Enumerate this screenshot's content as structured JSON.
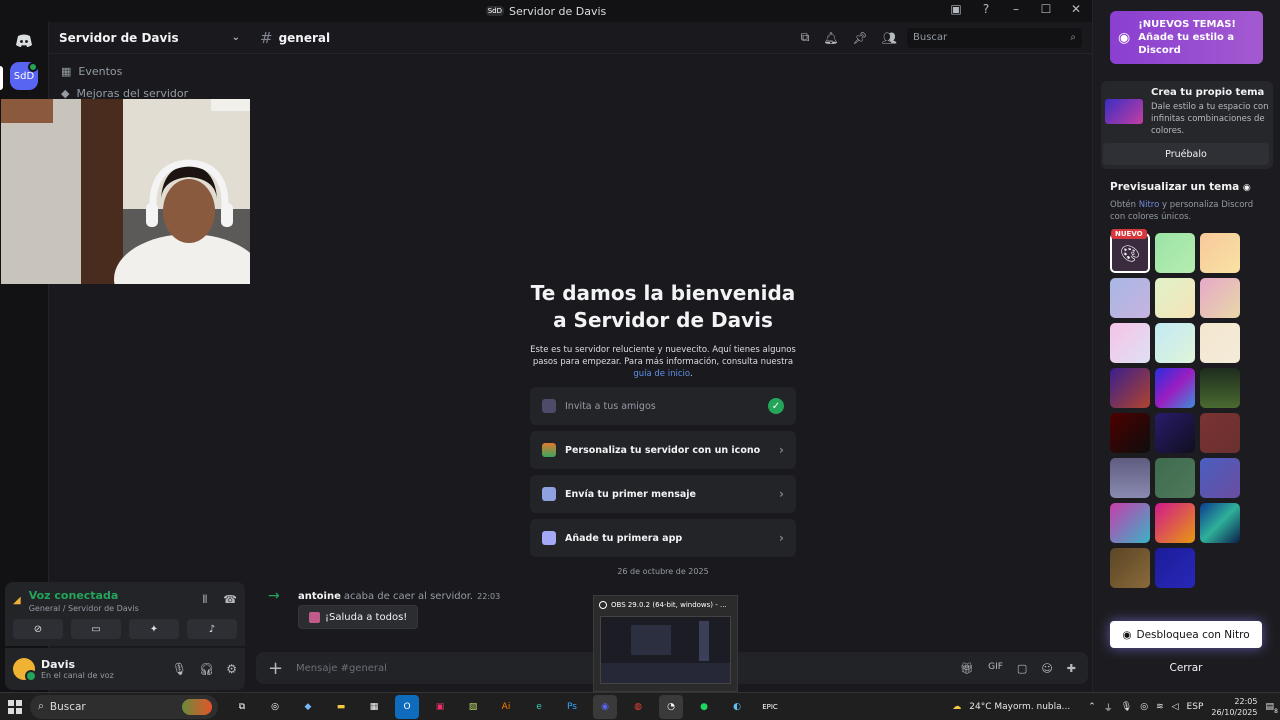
{
  "window": {
    "title": "Servidor de Davis",
    "server_initials": "SdD"
  },
  "rail": {
    "server_initials": "SdD"
  },
  "sidebar": {
    "server_name": "Servidor de Davis",
    "items": [
      {
        "label": "Eventos"
      },
      {
        "label": "Mejoras del servidor"
      }
    ]
  },
  "voice": {
    "status": "Voz conectada",
    "channel": "General / Servidor de Davis"
  },
  "user": {
    "name": "Davis",
    "status": "En el canal de voz"
  },
  "channel": {
    "name": "general",
    "search_placeholder": "Buscar"
  },
  "welcome": {
    "title": "Te damos la bienvenida a Servidor de Davis",
    "body": "Este es tu servidor reluciente y nuevecito. Aquí tienes algunos pasos para empezar. Para más información, consulta nuestra",
    "link": "guía de inicio",
    "tail": "."
  },
  "tasks": [
    {
      "label": "Invita a tus amigos",
      "done": true
    },
    {
      "label": "Personaliza tu servidor con un icono",
      "done": false
    },
    {
      "label": "Envía tu primer mensaje",
      "done": false
    },
    {
      "label": "Añade tu primera app",
      "done": false
    }
  ],
  "messages": {
    "date_divider": "26 de octubre de 2025",
    "join_user": "antoine",
    "join_text": "acaba de caer al servidor.",
    "join_time": "22:03",
    "wave_label": "¡Saluda a todos!"
  },
  "composer": {
    "placeholder": "Mensaje #general"
  },
  "obs": {
    "title": "OBS 29.0.2 (64-bit, windows) - ..."
  },
  "right_panel": {
    "promo": "¡NUEVOS TEMAS! Añade tu estilo a Discord",
    "card_title": "Crea tu propio tema",
    "card_desc": "Dale estilo a tu espacio con infinitas combinaciones de colores.",
    "card_button": "Pruébalo",
    "preview_title": "Previsualizar un tema",
    "preview_desc_1": "Obtén",
    "preview_desc_nitro": "Nitro",
    "preview_desc_2": "y personaliza Discord con colores únicos.",
    "new_badge": "NUEVO",
    "unlock": "Desbloquea con Nitro",
    "close": "Cerrar",
    "swatches": [
      "#3a2c3e",
      "linear-gradient(135deg,#9be3a6,#b6ecb0)",
      "linear-gradient(135deg,#f7c99b,#f9e2a3)",
      "linear-gradient(135deg,#a8b7e5,#c7b3df)",
      "linear-gradient(135deg,#dff3c8,#f6e3b8)",
      "linear-gradient(135deg,#e6a9c8,#e8d7a8)",
      "linear-gradient(135deg,#f6c3e5,#dfe0f5)",
      "linear-gradient(135deg,#c2e9f5,#dff5d9)",
      "linear-gradient(135deg,#f4e6cf,#f3ecd9)",
      "linear-gradient(135deg,#3a1f8c,#b0442c)",
      "linear-gradient(135deg,#2a2de0,#9b1ec0,#3c8ed8)",
      "linear-gradient(180deg,#1e2c1e,#4a6a30)",
      "linear-gradient(135deg,#4d0000,#0d0d0d)",
      "linear-gradient(135deg,#2a1b6b,#0f0f1f)",
      "linear-gradient(135deg,#7a3232,#6a3030)",
      "linear-gradient(180deg,#5f5c80,#8a8ab0)",
      "linear-gradient(135deg,#3f6a4f,#4e7a5a)",
      "linear-gradient(135deg,#4a5fc0,#6a4da0)",
      "linear-gradient(135deg,#c83da9,#39b3c8)",
      "linear-gradient(135deg,#d1188c,#e89a10)",
      "linear-gradient(135deg,#0a3b8f,#2fb09a,#0a1f4d)",
      "linear-gradient(135deg,#5a4525,#8a6a3a)",
      "linear-gradient(135deg,#1c1c9a,#2828b8)"
    ]
  },
  "taskbar": {
    "search": "Buscar",
    "weather": "24°C  Mayorm. nubla...",
    "lang": "ESP",
    "time": "22:05",
    "date": "26/10/2025",
    "notif_count": "8"
  }
}
